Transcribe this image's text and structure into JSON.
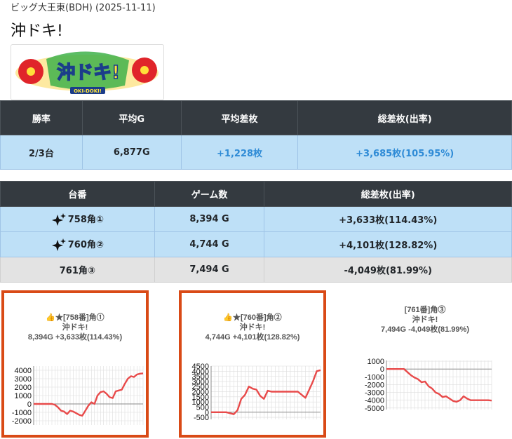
{
  "header": {
    "store_date": "ビッグ大王東(BDH) (2025-11-11)",
    "title": "沖ドキ!"
  },
  "logo": {
    "text": "沖ドキ!",
    "sub": "OKI-DOKI!"
  },
  "summary": {
    "headers": [
      "勝率",
      "平均G",
      "平均差枚",
      "総差枚(出率)"
    ],
    "values": [
      "2/3台",
      "6,877G",
      "+1,228枚",
      "+3,685枚(105.95%)"
    ]
  },
  "machines": {
    "headers": [
      "台番",
      "ゲーム数",
      "総差枚(出率)"
    ],
    "rows": [
      {
        "id": "758角①",
        "games": "8,394 G",
        "diff": "+3,633枚(114.43%)"
      },
      {
        "id": "760角②",
        "games": "4,744 G",
        "diff": "+4,101枚(128.82%)"
      },
      {
        "id": "761角③",
        "games": "7,494 G",
        "diff": "-4,049枚(81.99%)"
      }
    ]
  },
  "charts": [
    {
      "title_lines": [
        "👍★[758番]角①",
        "沖ドキ!",
        "8,394G +3,633枚(114.43%)"
      ],
      "chart_data": {
        "type": "line",
        "ylim": [
          -2500,
          4500
        ],
        "yticks": [
          4000,
          3000,
          2000,
          1000,
          0,
          -1000,
          -2000
        ],
        "ytick_labels": [
          "4000",
          "3000",
          "2000",
          "1000",
          "0",
          "-1000",
          "-2000"
        ],
        "values": [
          0,
          0,
          0,
          0,
          0,
          0,
          0,
          -100,
          -400,
          -800,
          -900,
          -1200,
          -800,
          -900,
          -1100,
          -1300,
          -1400,
          -800,
          -200,
          200,
          0,
          1000,
          1400,
          1500,
          1200,
          800,
          700,
          1500,
          1600,
          1700,
          2400,
          3000,
          3300,
          3200,
          3500,
          3600,
          3633
        ]
      }
    },
    {
      "title_lines": [
        "👍★[760番]角②",
        "沖ドキ!",
        "4,744G +4,101枚(128.82%)"
      ],
      "chart_data": {
        "type": "line",
        "ylim": [
          -700,
          4500
        ],
        "yticks": [
          4500,
          4000,
          3500,
          3000,
          2500,
          2000,
          1500,
          1000,
          500,
          0,
          -500
        ],
        "ytick_labels": [
          "4500",
          "4000",
          "3500",
          "3000",
          "2500",
          "2000",
          "1500",
          "1000",
          "500",
          "0",
          "-500"
        ],
        "values": [
          0,
          0,
          0,
          0,
          0,
          -100,
          -200,
          200,
          1300,
          1700,
          2500,
          2300,
          2200,
          1600,
          1300,
          2100,
          2000,
          2000,
          2000,
          2000,
          2000,
          2000,
          2000,
          2000,
          1700,
          1400,
          2200,
          3000,
          4000,
          4101
        ]
      }
    },
    {
      "title_lines": [
        "[761番]角③",
        "沖ドキ!",
        "7,494G -4,049枚(81.99%)"
      ],
      "chart_data": {
        "type": "line",
        "ylim": [
          -5200,
          1100
        ],
        "yticks": [
          1000,
          0,
          -1000,
          -2000,
          -3000,
          -4000,
          -5000
        ],
        "ytick_labels": [
          "1000",
          "0",
          "-1000",
          "-2000",
          "-3000",
          "-4000",
          "-5000"
        ],
        "values": [
          0,
          0,
          0,
          0,
          0,
          0,
          -400,
          -800,
          -1100,
          -1300,
          -1700,
          -1600,
          -2200,
          -2500,
          -3000,
          -3200,
          -3600,
          -3500,
          -3800,
          -4100,
          -4200,
          -4000,
          -3500,
          -3800,
          -4000,
          -4000,
          -4000,
          -4000,
          -4000,
          -4000,
          -4049
        ]
      }
    }
  ],
  "colors": {
    "line": "#e84a4a",
    "selected_border": "#d94a16",
    "header_bg": "#343a40",
    "row_blue": "#bee0f7",
    "row_gray": "#e3e3e3",
    "positive": "#2f8bd6"
  }
}
